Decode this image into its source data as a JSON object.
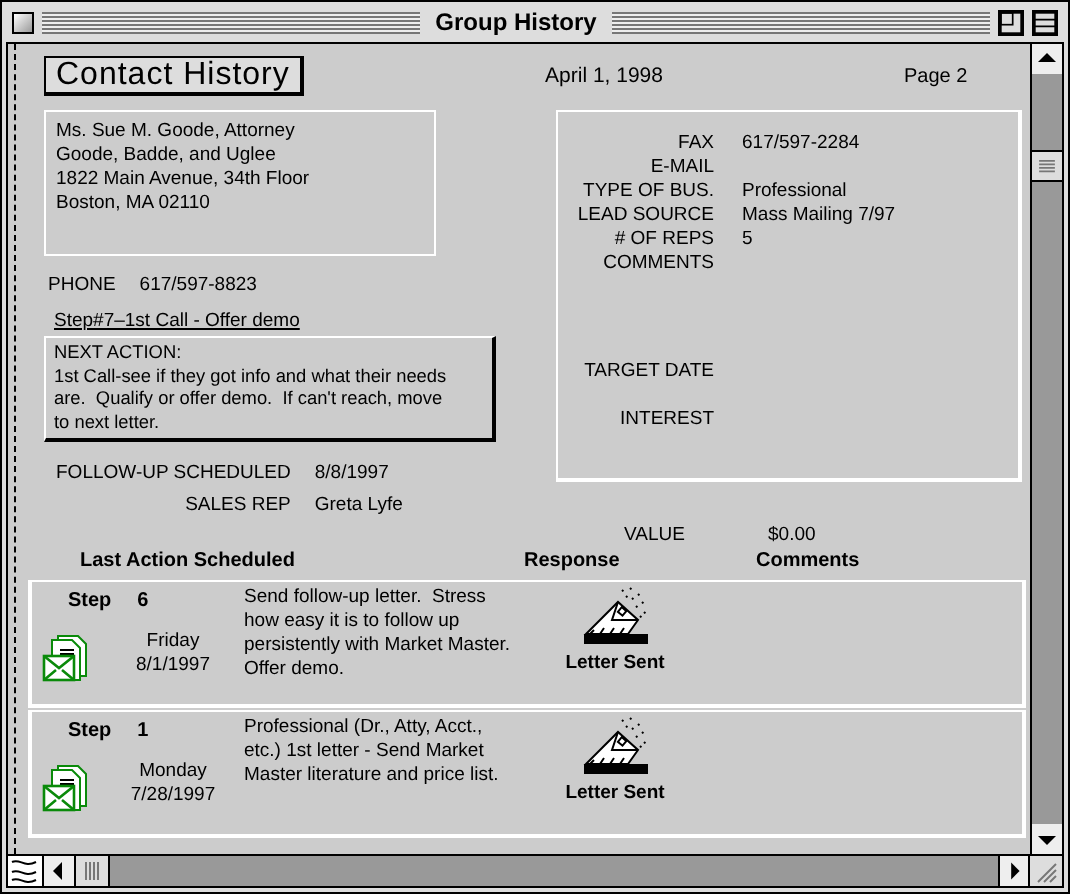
{
  "window": {
    "title": "Group History"
  },
  "header": {
    "title": "Contact History",
    "date": "April 1, 1998",
    "page": "Page 2"
  },
  "address": [
    "Ms. Sue M. Goode, Attorney",
    "Goode, Badde, and Uglee",
    "1822 Main Avenue, 34th Floor",
    "Boston, MA 02110"
  ],
  "phone": {
    "label": "PHONE",
    "value": "617/597-8823"
  },
  "step_link": "Step#7–1st Call - Offer demo",
  "next_action": {
    "label": "NEXT ACTION:",
    "text": "1st Call-see if they got info and what their needs are.  Qualify or offer demo.  If can't reach, move to next letter."
  },
  "schedule": [
    {
      "label": "FOLLOW-UP SCHEDULED",
      "value": "8/8/1997"
    },
    {
      "label": "SALES REP",
      "value": "Greta Lyfe"
    }
  ],
  "details": [
    {
      "label": "FAX",
      "value": "617/597-2284"
    },
    {
      "label": "E-MAIL"
    },
    {
      "label": "TYPE OF BUS.",
      "value": "Professional"
    },
    {
      "label": "LEAD SOURCE",
      "value": "Mass Mailing 7/97"
    },
    {
      "label": "# OF REPS",
      "value": "5"
    },
    {
      "label": "COMMENTS"
    }
  ],
  "details_lower": [
    {
      "label": "TARGET DATE"
    },
    {
      "label": "INTEREST"
    }
  ],
  "value": {
    "label": "VALUE",
    "value": "$0.00"
  },
  "columns": [
    "Last Action Scheduled",
    "Response",
    "Comments"
  ],
  "steps": [
    {
      "step_label": "Step",
      "number": "6",
      "day": "Friday",
      "date": "8/1/1997",
      "action": "Send follow-up letter.  Stress how easy it is to follow up persistently with Market Master.  Offer demo.",
      "response": "Letter Sent"
    },
    {
      "step_label": "Step",
      "number": "1",
      "day": "Monday",
      "date": "7/28/1997",
      "action": "Professional (Dr., Atty, Acct., etc.) 1st letter - Send Market Master literature and price list.",
      "response": "Letter Sent"
    }
  ]
}
